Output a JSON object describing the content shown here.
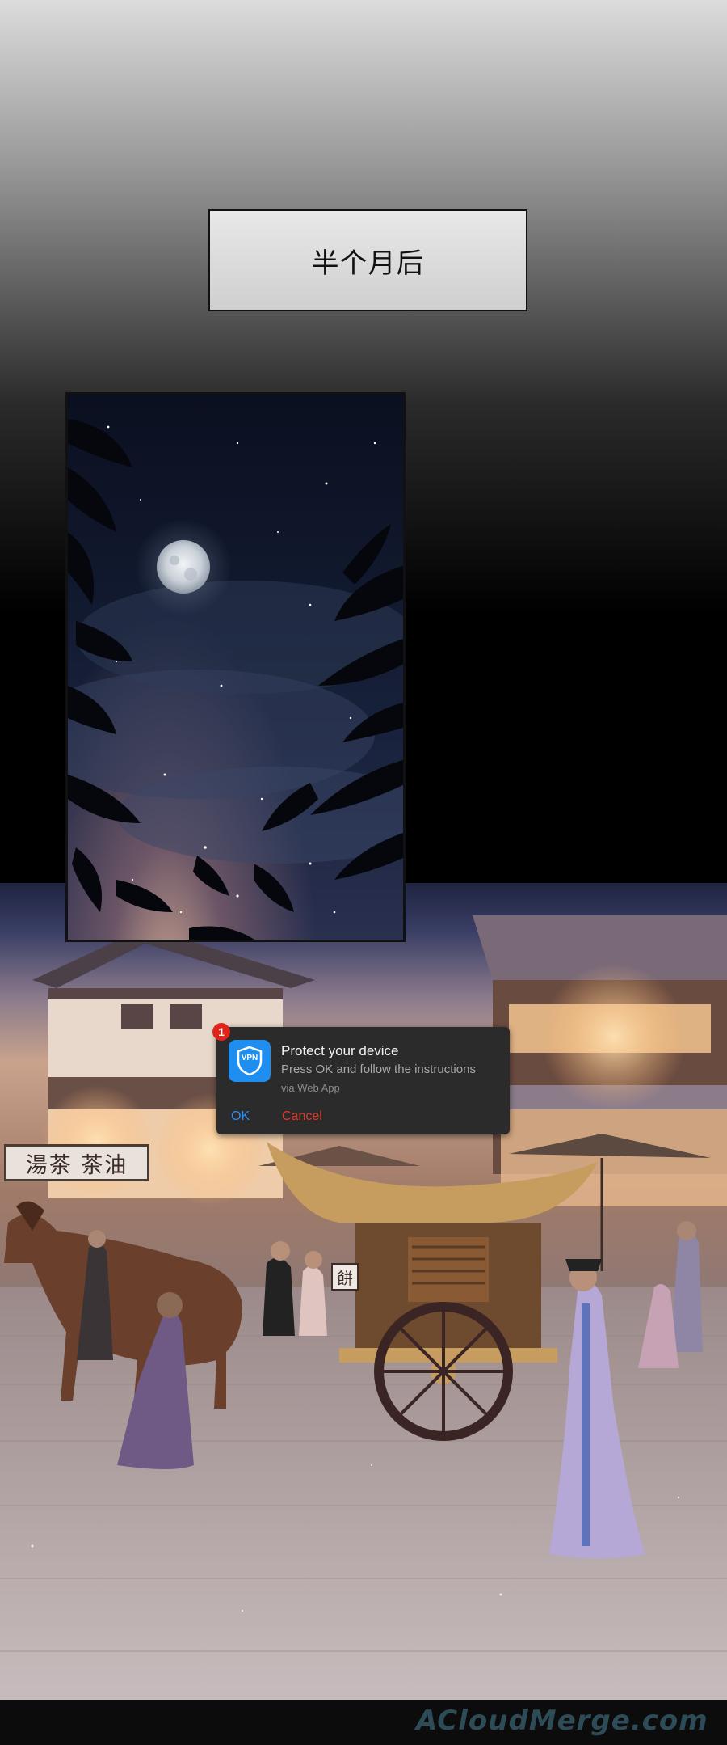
{
  "caption": {
    "text": "半个月后"
  },
  "notification": {
    "badge_count": "1",
    "app_icon": "vpn-shield-icon",
    "app_icon_label": "VPN",
    "title": "Protect your device",
    "body": "Press OK and follow the instructions",
    "source": "via Web App",
    "ok_label": "OK",
    "cancel_label": "Cancel",
    "colors": {
      "background": "#2b2b2b",
      "ok": "#2f8cf0",
      "cancel": "#e5362b",
      "badge": "#e0241b",
      "icon": "#1f8ef1"
    }
  },
  "scene": {
    "shop_sign": "湯茶 茶油",
    "cart_sign": "餅",
    "watermark": "ACloudMerge.com"
  }
}
